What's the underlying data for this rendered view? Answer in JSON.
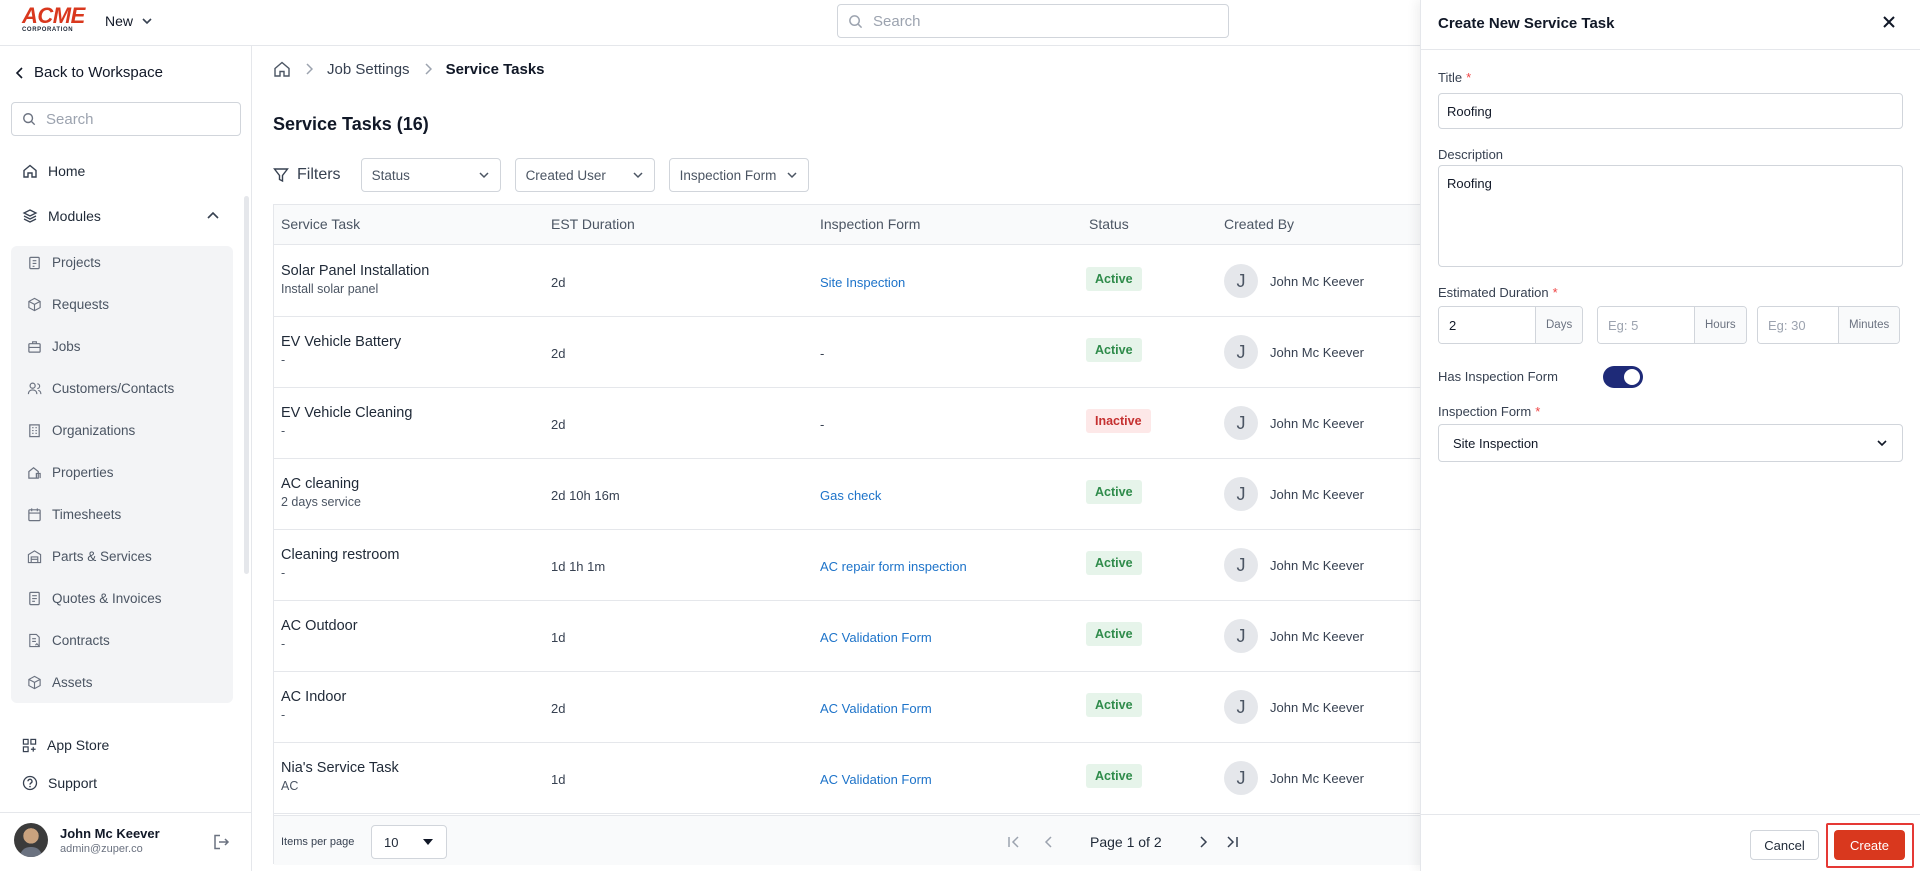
{
  "brand": {
    "logo_main": "ACME",
    "logo_sub": "CORPORATION",
    "accent": "#d9381e"
  },
  "topbar": {
    "new_label": "New",
    "search_placeholder": "Search"
  },
  "sidebar": {
    "back_label": "Back to Workspace",
    "search_placeholder": "Search",
    "home_label": "Home",
    "modules_label": "Modules",
    "modules": [
      {
        "label": "Projects",
        "icon": "clipboard-icon"
      },
      {
        "label": "Requests",
        "icon": "cube-icon"
      },
      {
        "label": "Jobs",
        "icon": "briefcase-icon"
      },
      {
        "label": "Customers/Contacts",
        "icon": "users-icon"
      },
      {
        "label": "Organizations",
        "icon": "building-icon"
      },
      {
        "label": "Properties",
        "icon": "property-icon"
      },
      {
        "label": "Timesheets",
        "icon": "calendar-icon"
      },
      {
        "label": "Parts & Services",
        "icon": "warehouse-icon"
      },
      {
        "label": "Quotes & Invoices",
        "icon": "invoice-icon"
      },
      {
        "label": "Contracts",
        "icon": "contract-icon"
      },
      {
        "label": "Assets",
        "icon": "box-icon"
      }
    ],
    "app_store_label": "App Store",
    "support_label": "Support",
    "user": {
      "name": "John Mc Keever",
      "email": "admin@zuper.co"
    }
  },
  "breadcrumb": {
    "section": "Job Settings",
    "current": "Service Tasks"
  },
  "page": {
    "title": "Service Tasks (16)"
  },
  "filters": {
    "label": "Filters",
    "status": "Status",
    "created_user": "Created User",
    "inspection_form": "Inspection Form"
  },
  "table": {
    "headers": {
      "task": "Service Task",
      "duration": "EST Duration",
      "form": "Inspection Form",
      "status": "Status",
      "created_by": "Created By"
    },
    "rows": [
      {
        "name": "Solar Panel Installation",
        "sub": "Install solar panel",
        "duration": "2d",
        "form": "Site Inspection",
        "form_link": true,
        "status": "Active",
        "initial": "J",
        "created_by": "John Mc Keever"
      },
      {
        "name": "EV Vehicle Battery",
        "sub": "-",
        "duration": "2d",
        "form": "-",
        "form_link": false,
        "status": "Active",
        "initial": "J",
        "created_by": "John Mc Keever"
      },
      {
        "name": "EV Vehicle Cleaning",
        "sub": "-",
        "duration": "2d",
        "form": "-",
        "form_link": false,
        "status": "Inactive",
        "initial": "J",
        "created_by": "John Mc Keever"
      },
      {
        "name": "AC cleaning",
        "sub": "2 days service",
        "duration": "2d 10h 16m",
        "form": "Gas check",
        "form_link": true,
        "status": "Active",
        "initial": "J",
        "created_by": "John Mc Keever"
      },
      {
        "name": "Cleaning restroom",
        "sub": "-",
        "duration": "1d 1h 1m",
        "form": "AC repair form inspection",
        "form_link": true,
        "status": "Active",
        "initial": "J",
        "created_by": "John Mc Keever"
      },
      {
        "name": "AC Outdoor",
        "sub": "-",
        "duration": "1d",
        "form": "AC Validation Form",
        "form_link": true,
        "status": "Active",
        "initial": "J",
        "created_by": "John Mc Keever"
      },
      {
        "name": "AC Indoor",
        "sub": "-",
        "duration": "2d",
        "form": "AC Validation Form",
        "form_link": true,
        "status": "Active",
        "initial": "J",
        "created_by": "John Mc Keever"
      },
      {
        "name": "Nia's Service Task",
        "sub": "AC",
        "duration": "1d",
        "form": "AC Validation Form",
        "form_link": true,
        "status": "Active",
        "initial": "J",
        "created_by": "John Mc Keever"
      }
    ],
    "footer": {
      "per_page_label": "Items per page",
      "per_page_value": "10",
      "page_info": "Page 1 of 2"
    }
  },
  "drawer": {
    "title": "Create New Service Task",
    "title_label": "Title",
    "title_value": "Roofing",
    "description_label": "Description",
    "description_value": "Roofing",
    "duration_label": "Estimated Duration",
    "days_value": "2",
    "days_unit": "Days",
    "hours_placeholder": "Eg: 5",
    "hours_unit": "Hours",
    "minutes_placeholder": "Eg: 30",
    "minutes_unit": "Minutes",
    "has_form_label": "Has Inspection Form",
    "has_form_enabled": true,
    "form_label": "Inspection Form",
    "form_value": "Site Inspection",
    "cancel_label": "Cancel",
    "create_label": "Create"
  }
}
